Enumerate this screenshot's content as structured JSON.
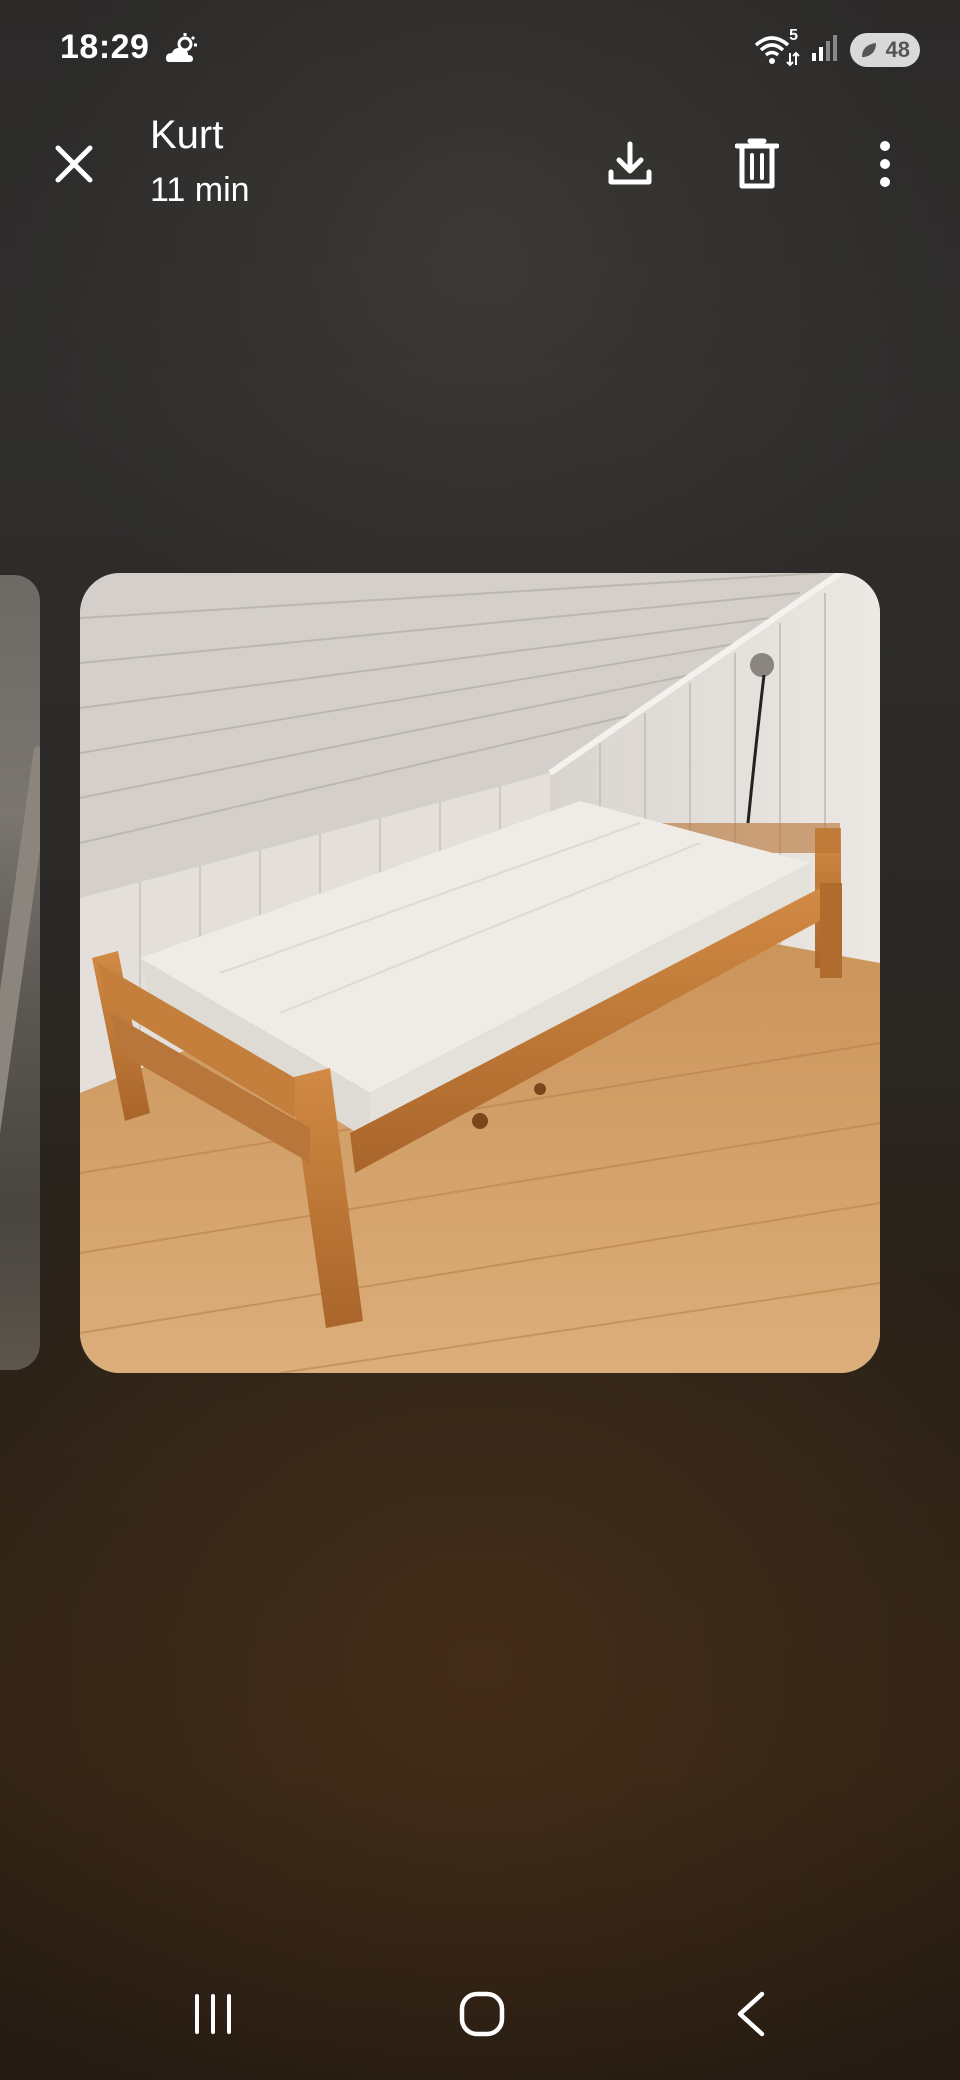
{
  "status_bar": {
    "time": "18:29",
    "weather_icon": "partly-cloudy-icon",
    "wifi_badge": "5",
    "battery": "48"
  },
  "header": {
    "title": "Kurt",
    "subtitle": "11 min",
    "actions": [
      "close-icon",
      "download-icon",
      "trash-icon",
      "more-vertical-icon"
    ]
  },
  "nav_bar": {
    "buttons": [
      "recent-apps-icon",
      "home-icon",
      "back-icon"
    ]
  },
  "colors": {
    "icon": "#ffffff",
    "battery_bg": "#d9d9d9",
    "wood": "#c27e3a",
    "floor": "#d6a16a",
    "mattress": "#eeebe6"
  }
}
